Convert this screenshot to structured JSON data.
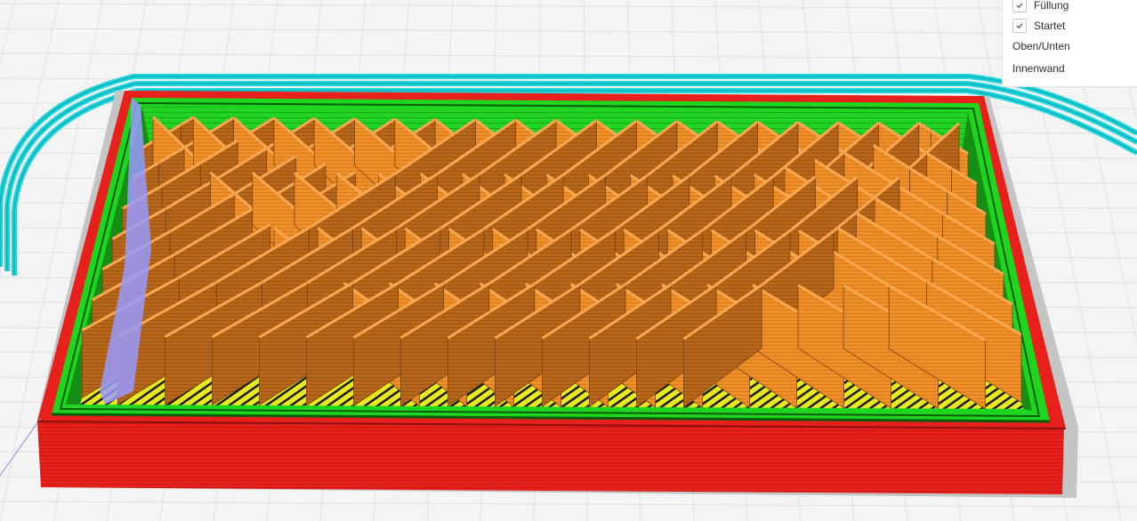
{
  "viewer": {
    "colors": {
      "background": "#f4f4f4",
      "grid_line": "#e3e3e3",
      "skirt": "#1ed6de",
      "outer_wall": "#e8201c",
      "outer_wall_dark": "#b51410",
      "inner_wall": "#22e022",
      "top_bottom": "#e8e81e",
      "infill": "#f0922a",
      "infill_dark": "#b0651a",
      "shell_shadow": "#bdbdbd",
      "support_purple": "#9a9aff"
    }
  },
  "legend": {
    "items": [
      {
        "label": "Füllung",
        "checked": true
      },
      {
        "label": "Startet",
        "checked": true
      },
      {
        "label": "Oben/Unten",
        "checked": null
      },
      {
        "label": "Innenwand",
        "checked": null
      }
    ]
  }
}
